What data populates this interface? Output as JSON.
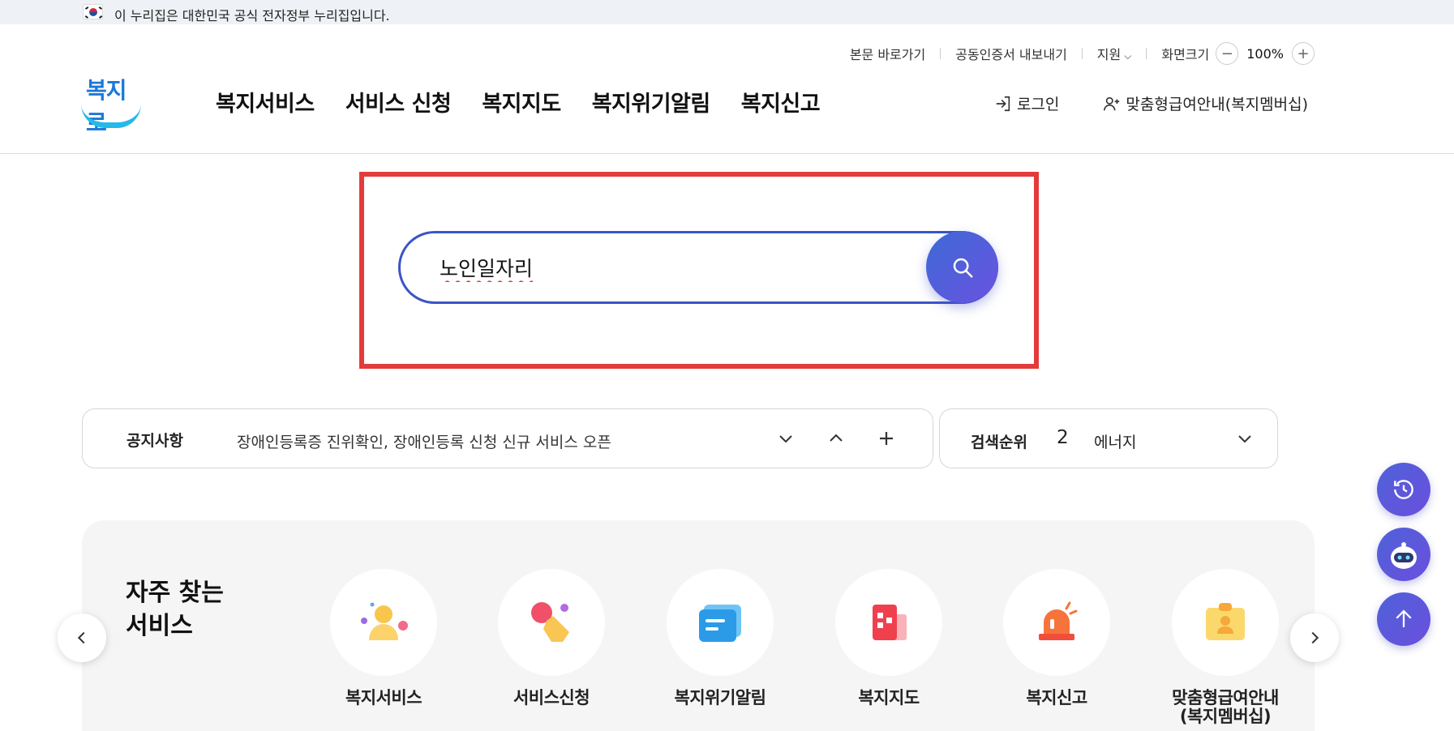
{
  "gov_banner": {
    "text": "이 누리집은 대한민국 공식 전자정부 누리집입니다."
  },
  "utility": {
    "skip_link": "본문 바로가기",
    "cert_export": "공동인증서 내보내기",
    "support": "지원",
    "zoom_label": "화면크기",
    "zoom_value": "100%"
  },
  "logo": {
    "text": "복지로"
  },
  "gnb": {
    "items": [
      "복지서비스",
      "서비스 신청",
      "복지지도",
      "복지위기알림",
      "복지신고"
    ]
  },
  "header_actions": {
    "login": "로그인",
    "membership": "맞춤형급여안내(복지멤버십)"
  },
  "search": {
    "value": "노인일자리",
    "placeholder": ""
  },
  "notice": {
    "title": "공지사항",
    "text": "장애인등록증 진위확인, 장애인등록 신청 신규 서비스 오픈"
  },
  "rank": {
    "title": "검색순위",
    "number": "2",
    "keyword": "에너지"
  },
  "frequent": {
    "title_line1": "자주 찾는",
    "title_line2": "서비스",
    "items": [
      {
        "label": "복지서비스",
        "icon": "person-icon"
      },
      {
        "label": "서비스신청",
        "icon": "tap-hand-icon"
      },
      {
        "label": "복지위기알림",
        "icon": "message-icon"
      },
      {
        "label": "복지지도",
        "icon": "building-icon"
      },
      {
        "label": "복지신고",
        "icon": "siren-icon"
      },
      {
        "label_line1": "맞춤형급여안내",
        "label_line2": "(복지멤버십)",
        "icon": "id-card-icon"
      }
    ]
  },
  "colors": {
    "brand_blue": "#3b55c7",
    "search_button": "#5a5fdc",
    "highlight_frame": "#e33b3b",
    "logo_blue": "#1d78d6",
    "logo_cyan": "#25b9ea"
  }
}
